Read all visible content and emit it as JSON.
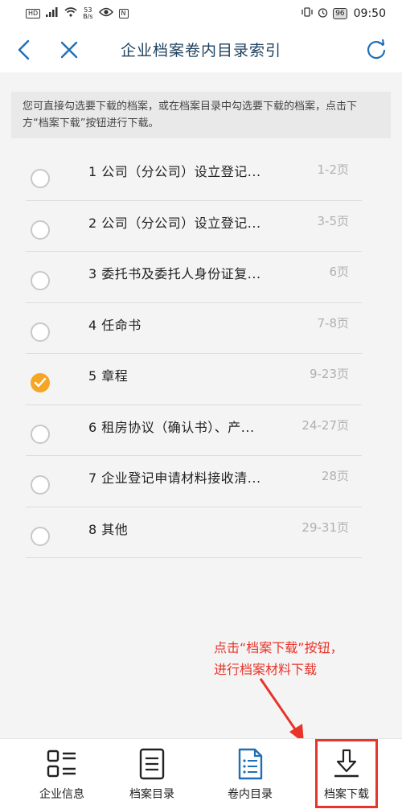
{
  "status_bar": {
    "badge": "HD",
    "net_speed_value": "53",
    "net_speed_unit": "B/s",
    "nfc": "N",
    "battery": "96",
    "time": "09:50"
  },
  "nav": {
    "title": "企业档案卷内目录索引",
    "back_icon": "chevron-left-icon",
    "close_icon": "close-icon",
    "refresh_icon": "refresh-icon"
  },
  "hint": "您可直接勾选要下载的档案，或在档案目录中勾选要下载的档案，点击下方“档案下载”按钮进行下载。",
  "items": [
    {
      "title": "1 公司（分公司）设立登记...",
      "pages": "1-2页",
      "checked": false
    },
    {
      "title": "2 公司（分公司）设立登记...",
      "pages": "3-5页",
      "checked": false
    },
    {
      "title": "3 委托书及委托人身份证复...",
      "pages": "6页",
      "checked": false
    },
    {
      "title": "4 任命书",
      "pages": "7-8页",
      "checked": false
    },
    {
      "title": "5 章程",
      "pages": "9-23页",
      "checked": true
    },
    {
      "title": "6 租房协议（确认书）、产...",
      "pages": "24-27页",
      "checked": false
    },
    {
      "title": "7 企业登记申请材料接收清...",
      "pages": "28页",
      "checked": false
    },
    {
      "title": "8 其他",
      "pages": "29-31页",
      "checked": false
    }
  ],
  "annotation": {
    "line1": "点击“档案下载”按钮，",
    "line2": "进行档案材料下载"
  },
  "tabs": [
    {
      "label": "企业信息",
      "icon": "grid-list-icon"
    },
    {
      "label": "档案目录",
      "icon": "document-icon"
    },
    {
      "label": "卷内目录",
      "icon": "document-list-icon"
    },
    {
      "label": "档案下载",
      "icon": "download-icon"
    }
  ],
  "colors": {
    "nav_title": "#20425f",
    "accent_blue": "#1f6fb8",
    "checked": "#f5a623",
    "annotation_red": "#e8342a"
  }
}
